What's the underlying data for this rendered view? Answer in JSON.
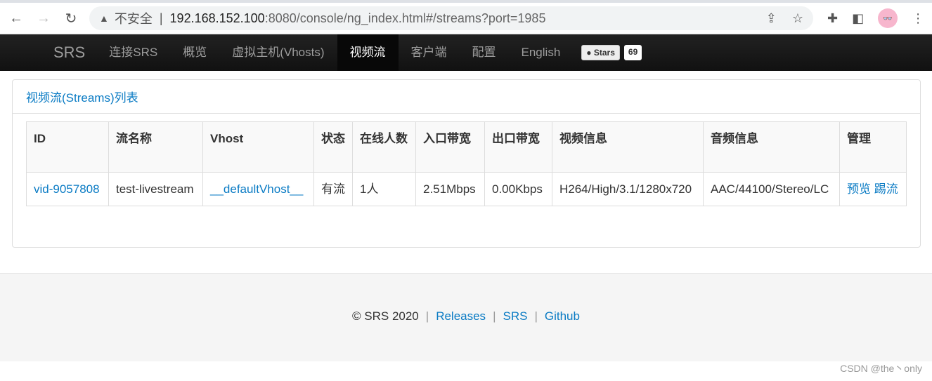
{
  "browser": {
    "security_label": "不安全",
    "url_host": "192.168.152.100",
    "url_rest": ":8080/console/ng_index.html#/streams?port=1985"
  },
  "nav": {
    "brand": "SRS",
    "items": [
      "连接SRS",
      "概览",
      "虚拟主机(Vhosts)",
      "视频流",
      "客户端",
      "配置",
      "English"
    ],
    "active": "视频流",
    "github_stars_label": "Stars",
    "github_stars_count": "69"
  },
  "panel": {
    "title": "视频流(Streams)列表"
  },
  "table": {
    "headers": [
      "ID",
      "流名称",
      "Vhost",
      "状态",
      "在线人数",
      "入口带宽",
      "出口带宽",
      "视频信息",
      "音频信息",
      "管理"
    ],
    "rows": [
      {
        "id": "vid-9057808",
        "name": "test-livestream",
        "vhost": "__defaultVhost__",
        "status": "有流",
        "clients": "1人",
        "in_bw": "2.51Mbps",
        "out_bw": "0.00Kbps",
        "video": "H264/High/3.1/1280x720",
        "audio": "AAC/44100/Stereo/LC",
        "actions": [
          "预览",
          "踢流"
        ]
      }
    ]
  },
  "footer": {
    "copyright": "© SRS 2020",
    "links": [
      "Releases",
      "SRS",
      "Github"
    ]
  },
  "watermark": "CSDN @the丶only"
}
